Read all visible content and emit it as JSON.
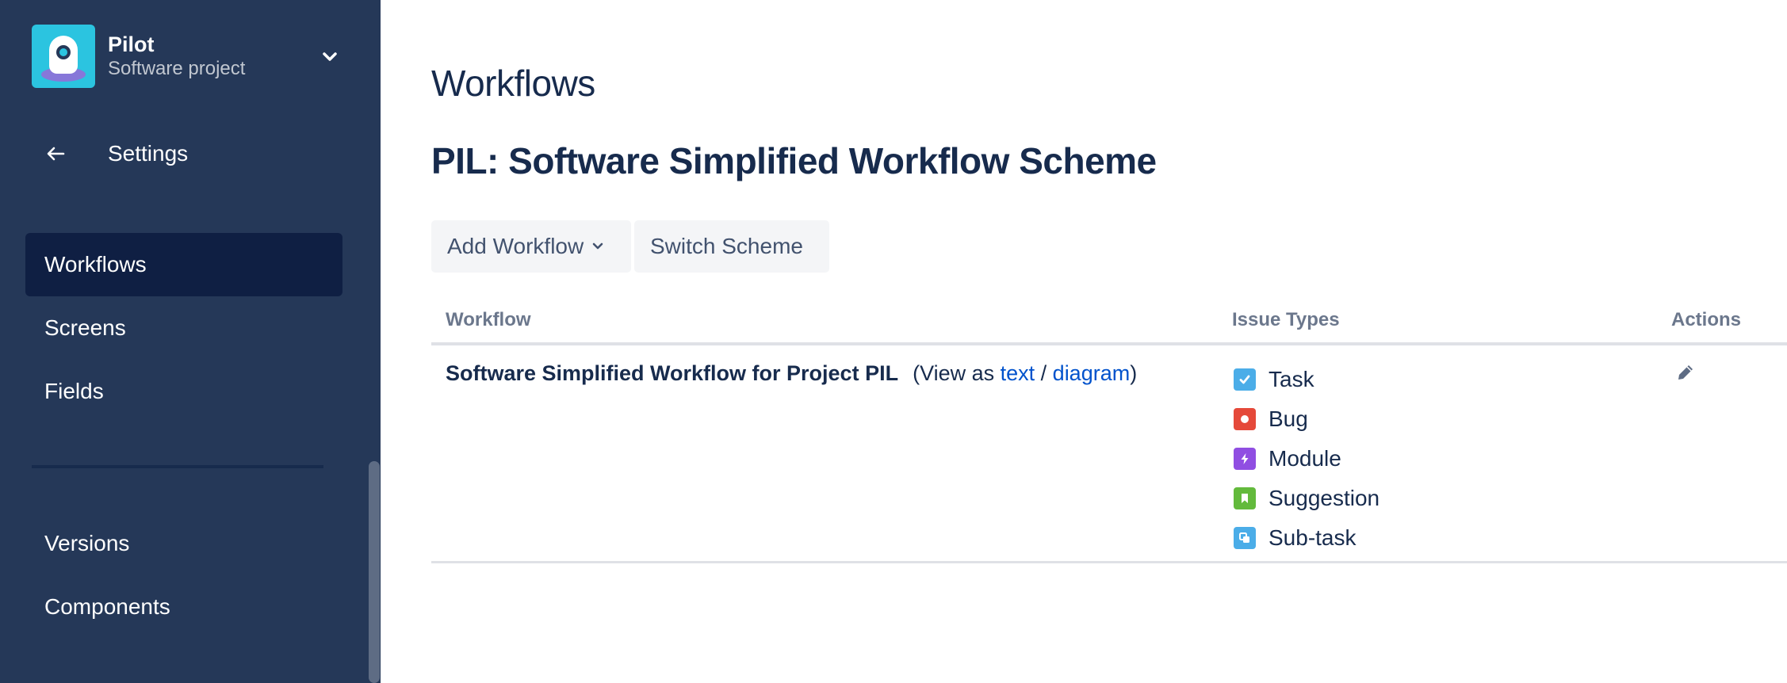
{
  "sidebar": {
    "project": {
      "name": "Pilot",
      "type": "Software project",
      "avatar_icon": "spaceship-avatar",
      "dropdown_icon": "chevron-down-icon"
    },
    "back": {
      "icon": "arrow-left-icon",
      "label": "Settings"
    },
    "items": [
      {
        "label": "Workflows",
        "active": true
      },
      {
        "label": "Screens",
        "active": false
      },
      {
        "label": "Fields",
        "active": false
      },
      {
        "label": "Versions",
        "active": false
      },
      {
        "label": "Components",
        "active": false
      }
    ]
  },
  "main": {
    "title": "Workflows",
    "scheme_title": "PIL: Software Simplified Workflow Scheme",
    "buttons": {
      "add_workflow": "Add Workflow",
      "switch_scheme": "Switch Scheme"
    },
    "table": {
      "headers": {
        "workflow": "Workflow",
        "issue_types": "Issue Types",
        "actions": "Actions"
      },
      "rows": [
        {
          "workflow_name": "Software Simplified Workflow for Project PIL",
          "view_prefix": "(View as ",
          "view_text_link": "text",
          "view_separator": " / ",
          "view_diagram_link": "diagram",
          "view_suffix": ")",
          "issue_types": [
            {
              "name": "Task",
              "icon": "task-icon",
              "color": "#4bade8"
            },
            {
              "name": "Bug",
              "icon": "bug-icon",
              "color": "#e5493a"
            },
            {
              "name": "Module",
              "icon": "module-icon",
              "color": "#904ee2"
            },
            {
              "name": "Suggestion",
              "icon": "suggestion-icon",
              "color": "#63ba3c"
            },
            {
              "name": "Sub-task",
              "icon": "subtask-icon",
              "color": "#4bade8"
            }
          ],
          "action_icon": "pencil-icon"
        }
      ]
    }
  },
  "colors": {
    "sidebar_bg": "#253858",
    "sidebar_active": "#0f1f43",
    "link": "#0052cc",
    "text": "#172b4d"
  }
}
